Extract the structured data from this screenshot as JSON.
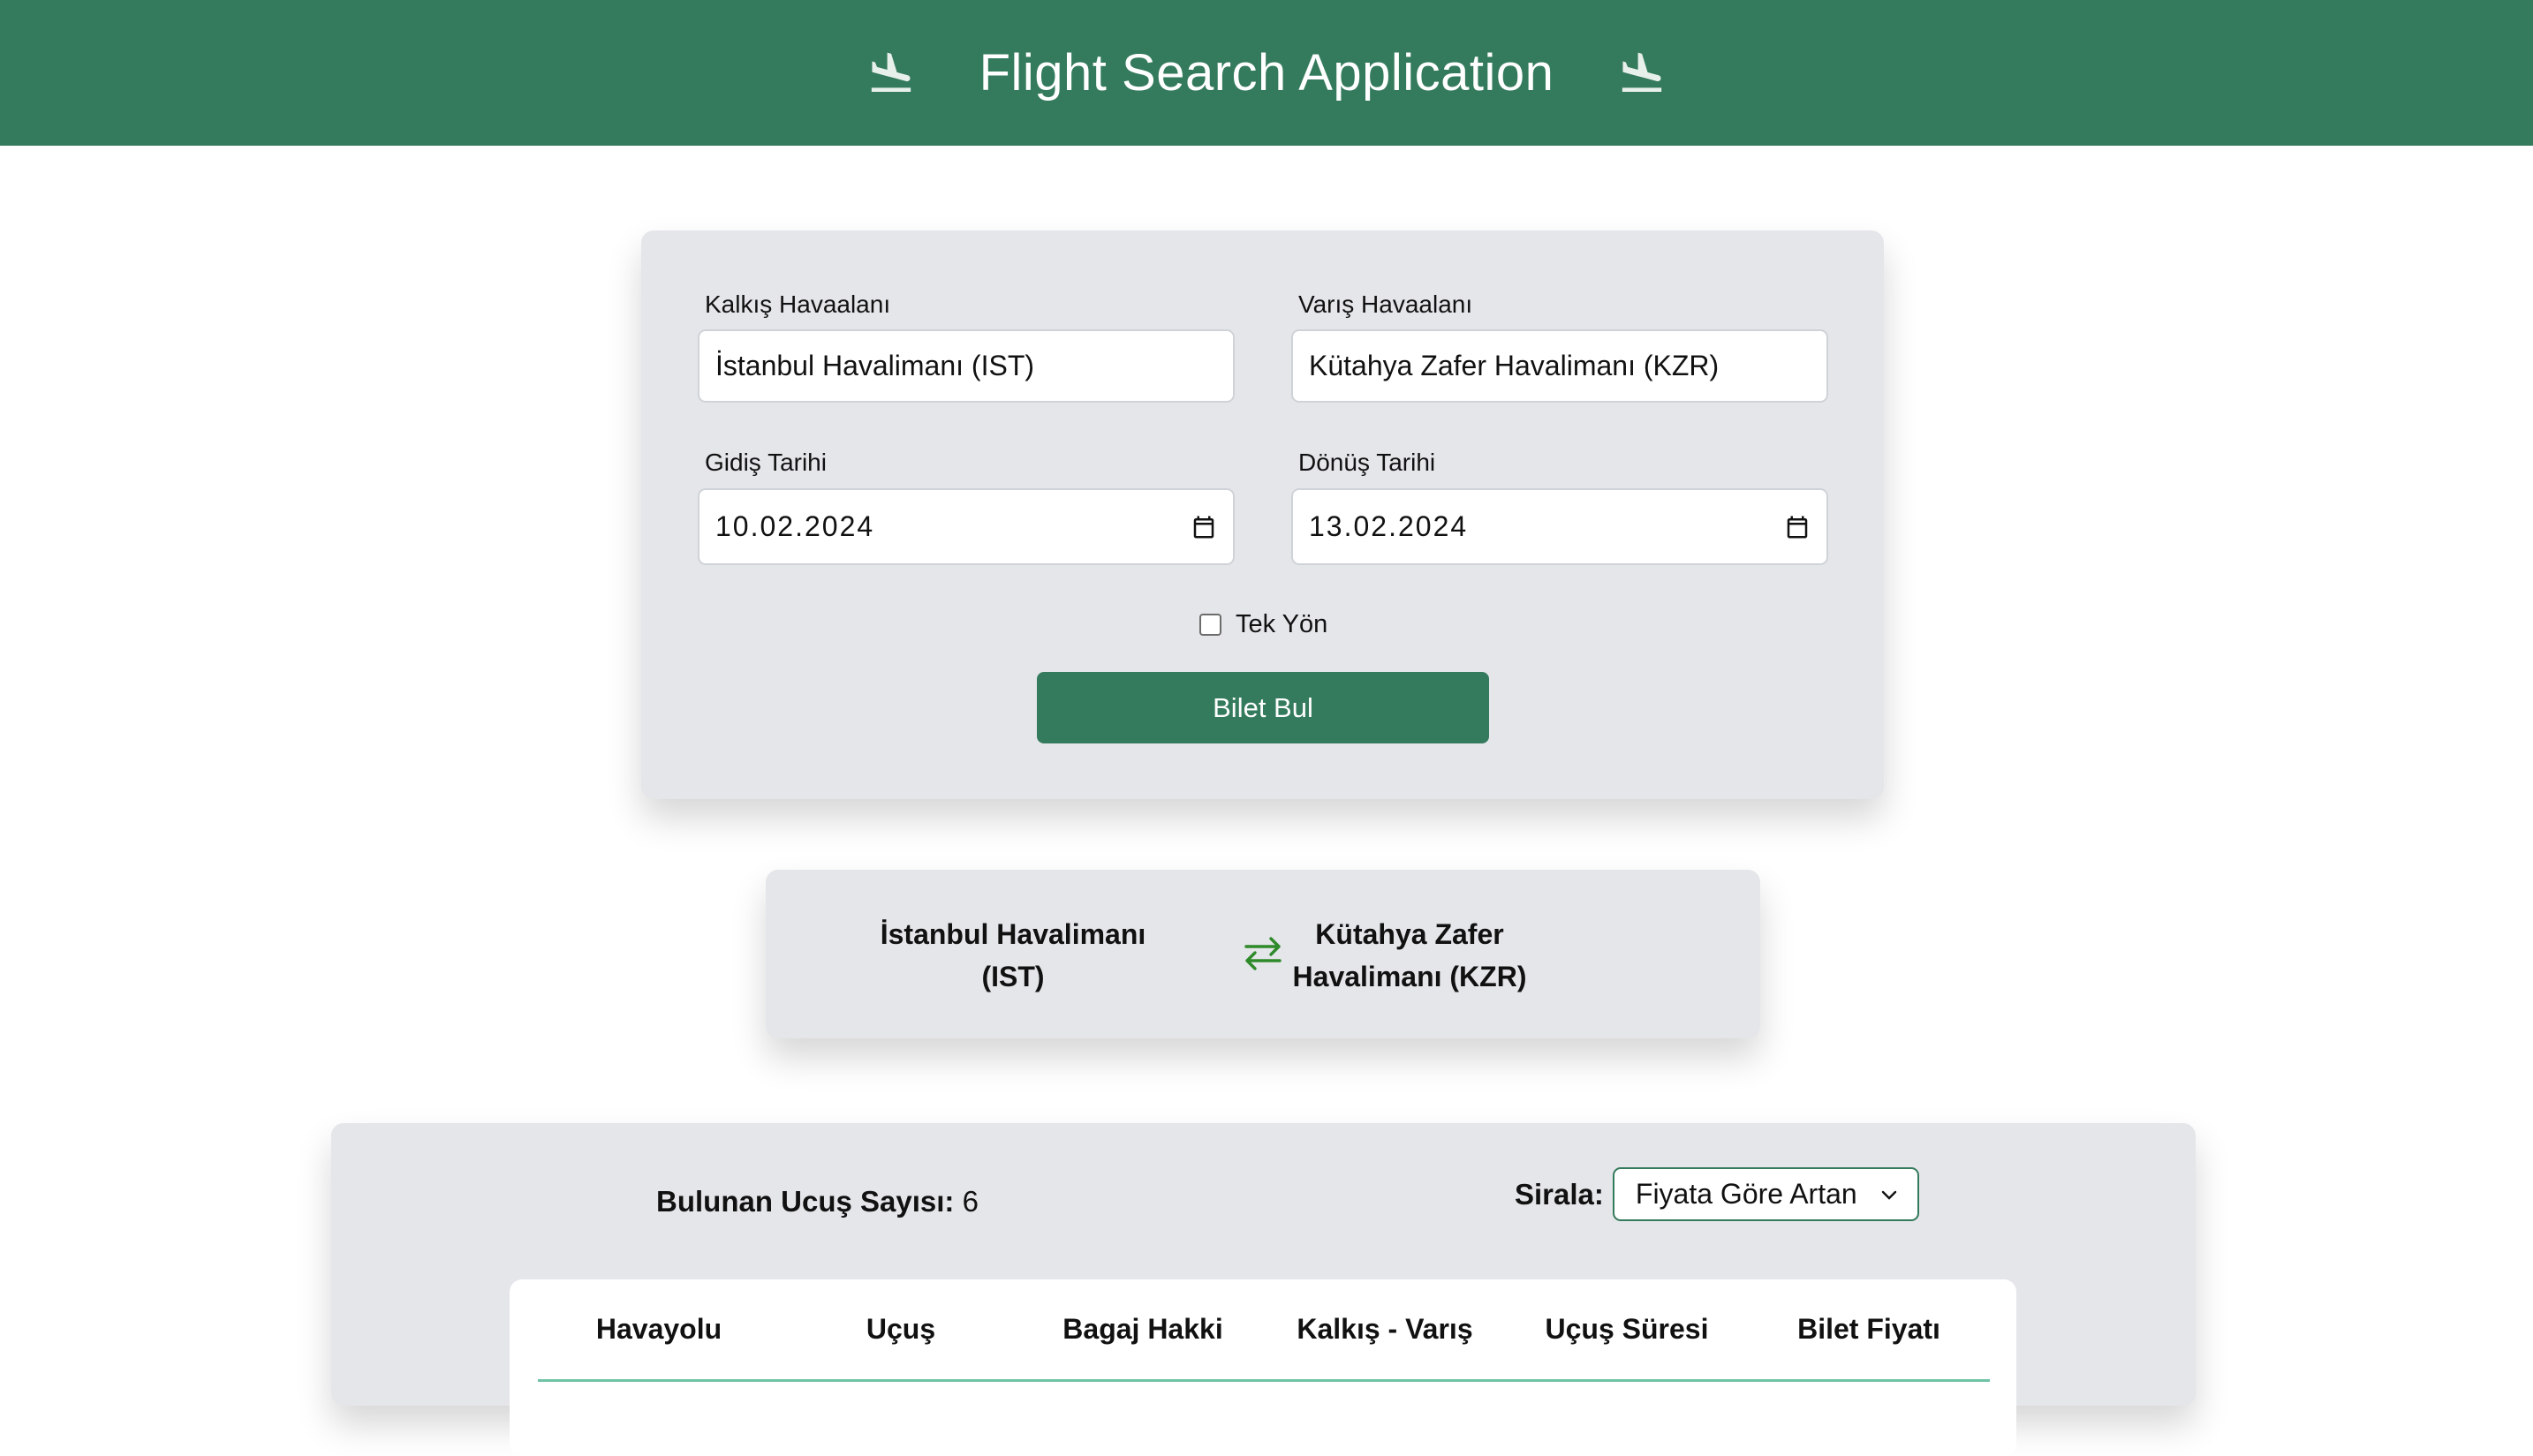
{
  "header": {
    "title": "Flight Search Application",
    "left_icon": "flight-land-icon",
    "right_icon": "flight-land-icon",
    "color": "#347a5c"
  },
  "search": {
    "departure_label": "Kalkış Havaalanı",
    "departure_value": "İstanbul Havalimanı (IST)",
    "arrival_label": "Varış Havaalanı",
    "arrival_value": "Kütahya Zafer Havalimanı (KZR)",
    "depart_date_label": "Gidiş Tarihi",
    "depart_date_value": "10.02.2024",
    "return_date_label": "Dönüş Tarihi",
    "return_date_value": "13.02.2024",
    "one_way_label": "Tek Yön",
    "one_way_checked": false,
    "submit_label": "Bilet Bul"
  },
  "route": {
    "from": "İstanbul Havalimanı (IST)",
    "to": "Kütahya Zafer Havalimanı (KZR)",
    "icon": "swap-arrows-icon"
  },
  "results": {
    "count_label": "Bulunan Ucuş Sayısı:",
    "count_value": "6",
    "sort_label": "Sirala:",
    "sort_value": "Fiyata Göre Artan",
    "columns": [
      "Havayolu",
      "Uçuş",
      "Bagaj Hakki",
      "Kalkış - Varış",
      "Uçuş Süresi",
      "Bilet Fiyatı"
    ]
  }
}
